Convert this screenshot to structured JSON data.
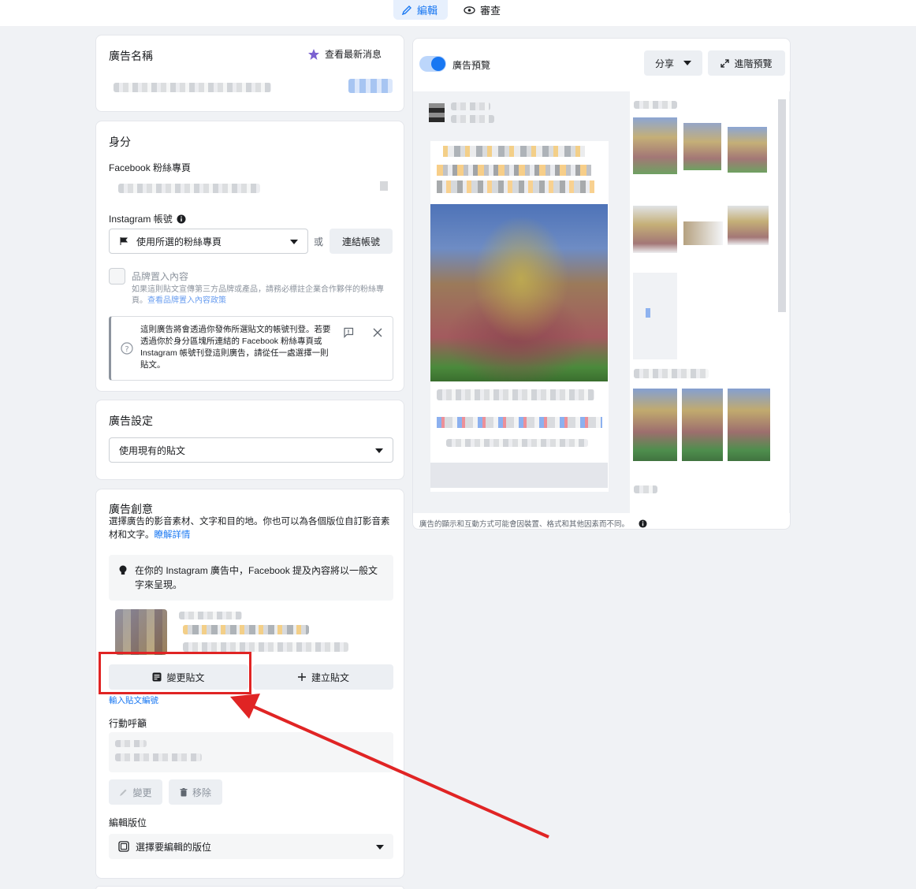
{
  "tabs": {
    "edit": "編輯",
    "review": "審查"
  },
  "ad_name": {
    "title": "廣告名稱",
    "latest_news": "查看最新消息"
  },
  "identity": {
    "title": "身分",
    "facebook_page_label": "Facebook 粉絲專頁",
    "instagram_label": "Instagram 帳號",
    "instagram_select": "使用所選的粉絲專頁",
    "or": "或",
    "connect_account": "連結帳號",
    "branded_content_label": "品牌置入內容",
    "branded_content_desc": "如果這則貼文宣傳第三方品牌或產品，請務必標註企業合作夥伴的粉絲專頁。",
    "branded_content_link": "查看品牌置入內容政策",
    "notice": "這則廣告將會透過你發佈所選貼文的帳號刊登。若要透過你於身分區塊所連結的 Facebook 粉絲專頁或 Instagram 帳號刊登這則廣告，請從任一處選擇一則貼文。"
  },
  "ad_setup": {
    "title": "廣告設定",
    "select": "使用現有的貼文"
  },
  "creative": {
    "title": "廣告創意",
    "desc": "選擇廣告的影音素材、文字和目的地。你也可以為各個版位自訂影音素材和文字。",
    "learn_more": "瞭解詳情",
    "tip": "在你的 Instagram 廣告中，Facebook 提及內容將以一般文字來呈現。",
    "change_post": "變更貼文",
    "create_post": "建立貼文",
    "enter_post_id": "輸入貼文編號",
    "cta_label": "行動呼籲",
    "change": "變更",
    "remove": "移除",
    "edit_placement_label": "編輯版位",
    "edit_placement_select": "選擇要編輯的版位"
  },
  "preview": {
    "toggle_label": "廣告預覽",
    "share": "分享",
    "advanced": "進階預覽",
    "footnote": "廣告的顯示和互動方式可能會因裝置、格式和其他因素而不同。"
  },
  "colors": {
    "accent": "#1877f2",
    "highlight": "#e02424"
  }
}
